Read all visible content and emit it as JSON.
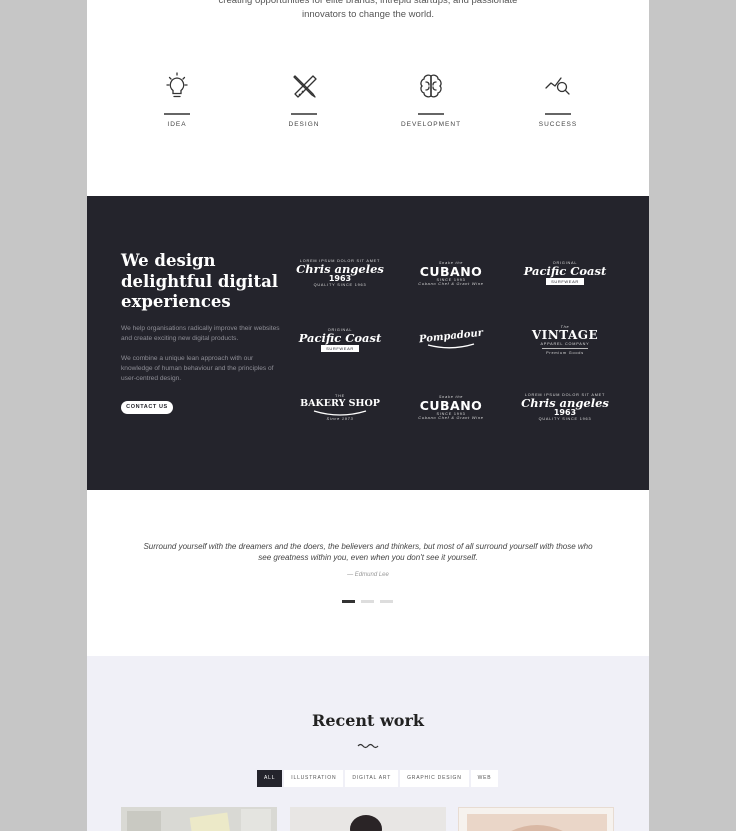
{
  "intro": {
    "text": "creating opportunities for elite brands, intrepid startups, and passionate innovators to change the world."
  },
  "features": [
    {
      "label": "IDEA",
      "icon": "lightbulb-icon"
    },
    {
      "label": "DESIGN",
      "icon": "pencil-ruler-icon"
    },
    {
      "label": "DEVELOPMENT",
      "icon": "brain-icon"
    },
    {
      "label": "SUCCESS",
      "icon": "magnifier-graph-icon"
    }
  ],
  "dark": {
    "title": "We design delightful digital experiences",
    "p1": "We help organisations radically improve their websites and create exciting new digital products.",
    "p2": "We combine a unique lean approach with our knowledge of human behaviour and the principles of user-centred design.",
    "contact_label": "CONTACT US",
    "bg_color": "#24242c"
  },
  "logos": {
    "chris": {
      "top": "LOREM IPSUM DOLOR SIT AMET",
      "name": "Chris angeles",
      "year": "1963",
      "bottom": "QUALITY SINCE 1963"
    },
    "cubano": {
      "top": "Snake the",
      "name": "CUBANO",
      "since": "SINCE 1993",
      "bottom": "Cubano Chef & Grant Wine"
    },
    "pacific": {
      "top": "ORIGINAL",
      "name": "Pacific Coast",
      "ribbon": "SURFWEAR"
    },
    "vintage": {
      "top": "The",
      "name": "VINTAGE",
      "sub": "APPAREL COMPANY",
      "bottom": "Premium Goods"
    },
    "pompadour": {
      "name": "Pompadour"
    },
    "bakery": {
      "top": "THE",
      "name": "BAKERY SHOP",
      "bottom": "Since 1973"
    }
  },
  "quote": {
    "text": "Surround yourself with the dreamers and the doers, the believers and thinkers, but most of all surround yourself with those who see greatness within you, even when you don't see it yourself.",
    "author": "— Edmund Lee"
  },
  "recent": {
    "title": "Recent work",
    "filters": [
      "ALL",
      "ILLUSTRATION",
      "DIGITAL ART",
      "GRAPHIC DESIGN",
      "WEB"
    ]
  }
}
